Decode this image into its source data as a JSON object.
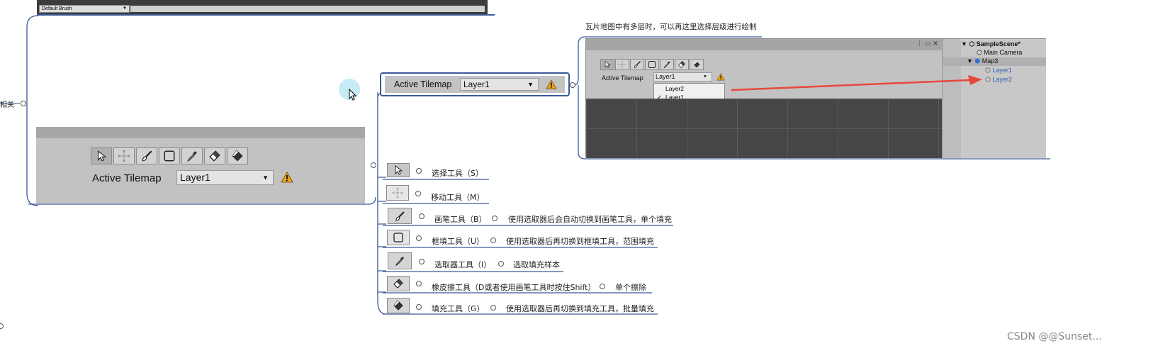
{
  "top_panel": {
    "brush_label": "Default Brush"
  },
  "left_node": {
    "label": "相关"
  },
  "active_tilemap": {
    "label": "Active Tilemap",
    "layer": "Layer1"
  },
  "palette": {
    "label": "Active Tilemap",
    "layer": "Layer1"
  },
  "layer_note": "瓦片地图中有多层时，可以再这里选择层级进行绘制",
  "unity": {
    "label": "Active Tilemap",
    "layer": "Layer1",
    "dropdown_options": [
      "Layer2",
      "Layer1"
    ],
    "checked_mark": "✓",
    "hierarchy": [
      "SampleScene*",
      "Main Camera",
      "Map3",
      "Layer1",
      "Layer2"
    ]
  },
  "tools": [
    {
      "name": "选择工具（S）",
      "desc": "",
      "icon": "select-icon"
    },
    {
      "name": "移动工具（M）",
      "desc": "",
      "icon": "move-icon"
    },
    {
      "name": "画笔工具（B）",
      "desc": "使用选取器后会自动切换到画笔工具，单个填充",
      "icon": "brush-icon"
    },
    {
      "name": "框填工具（U）",
      "desc": "使用选取器后再切换到框填工具，范围填充",
      "icon": "box-fill-icon"
    },
    {
      "name": "选取器工具（I）",
      "desc": "选取填充样本",
      "icon": "picker-icon"
    },
    {
      "name": "橡皮擦工具（D或者使用画笔工具时按住Shift）",
      "desc": "单个擦除",
      "icon": "eraser-icon"
    },
    {
      "name": "填充工具（G）",
      "desc": "使用选取器后再切换到填充工具，批量填充",
      "icon": "fill-icon"
    }
  ],
  "watermark": "CSDN @@Sunset..."
}
